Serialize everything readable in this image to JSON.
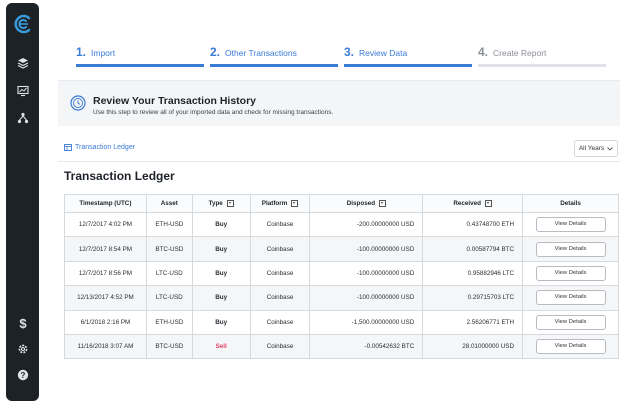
{
  "sidebar": {
    "icons": [
      "logo-icon",
      "layers-icon",
      "chart-monitor-icon",
      "network-icon",
      "dollar-icon",
      "gear-icon",
      "help-icon"
    ],
    "logo_color": "#3a9ad9"
  },
  "steps": [
    {
      "num": "1.",
      "label": "Import",
      "active": true
    },
    {
      "num": "2.",
      "label": "Other Transactions",
      "active": true
    },
    {
      "num": "3.",
      "label": "Review Data",
      "active": true
    },
    {
      "num": "4.",
      "label": "Create Report",
      "active": false
    }
  ],
  "review": {
    "title": "Review Your Transaction History",
    "subtitle": "Use this step to review all of your imported data and check for missing transactions."
  },
  "tabs": {
    "ledger_label": "Transaction Ledger",
    "year_filter": "All Years"
  },
  "ledger": {
    "title": "Transaction Ledger",
    "columns": [
      "Timestamp (UTC)",
      "Asset",
      "Type",
      "Platform",
      "Disposed",
      "Received",
      "Details"
    ],
    "details_label": "View Details",
    "rows": [
      {
        "timestamp": "12/7/2017 4:02 PM",
        "asset": "ETH-USD",
        "type": "Buy",
        "platform": "Coinbase",
        "disposed": "-200.00000000 USD",
        "received": "0.43748700 ETH"
      },
      {
        "timestamp": "12/7/2017 8:54 PM",
        "asset": "BTC-USD",
        "type": "Buy",
        "platform": "Coinbase",
        "disposed": "-100.00000000 USD",
        "received": "0.00587794 BTC"
      },
      {
        "timestamp": "12/7/2017 8:56 PM",
        "asset": "LTC-USD",
        "type": "Buy",
        "platform": "Coinbase",
        "disposed": "-100.00000000 USD",
        "received": "0.95882946 LTC"
      },
      {
        "timestamp": "12/13/2017 4:52 PM",
        "asset": "LTC-USD",
        "type": "Buy",
        "platform": "Coinbase",
        "disposed": "-100.00000000 USD",
        "received": "0.29715703 LTC"
      },
      {
        "timestamp": "6/1/2018 2:16 PM",
        "asset": "ETH-USD",
        "type": "Buy",
        "platform": "Coinbase",
        "disposed": "-1,500.00000000 USD",
        "received": "2.56206771 ETH"
      },
      {
        "timestamp": "11/16/2018 3:07 AM",
        "asset": "BTC-USD",
        "type": "Sell",
        "platform": "Coinbase",
        "disposed": "-0.00542632 BTC",
        "received": "28.01000000 USD"
      }
    ]
  },
  "colors": {
    "accent": "#3a7bd5",
    "sell": "#e0456b",
    "sidebar_bg": "#1d2227"
  }
}
